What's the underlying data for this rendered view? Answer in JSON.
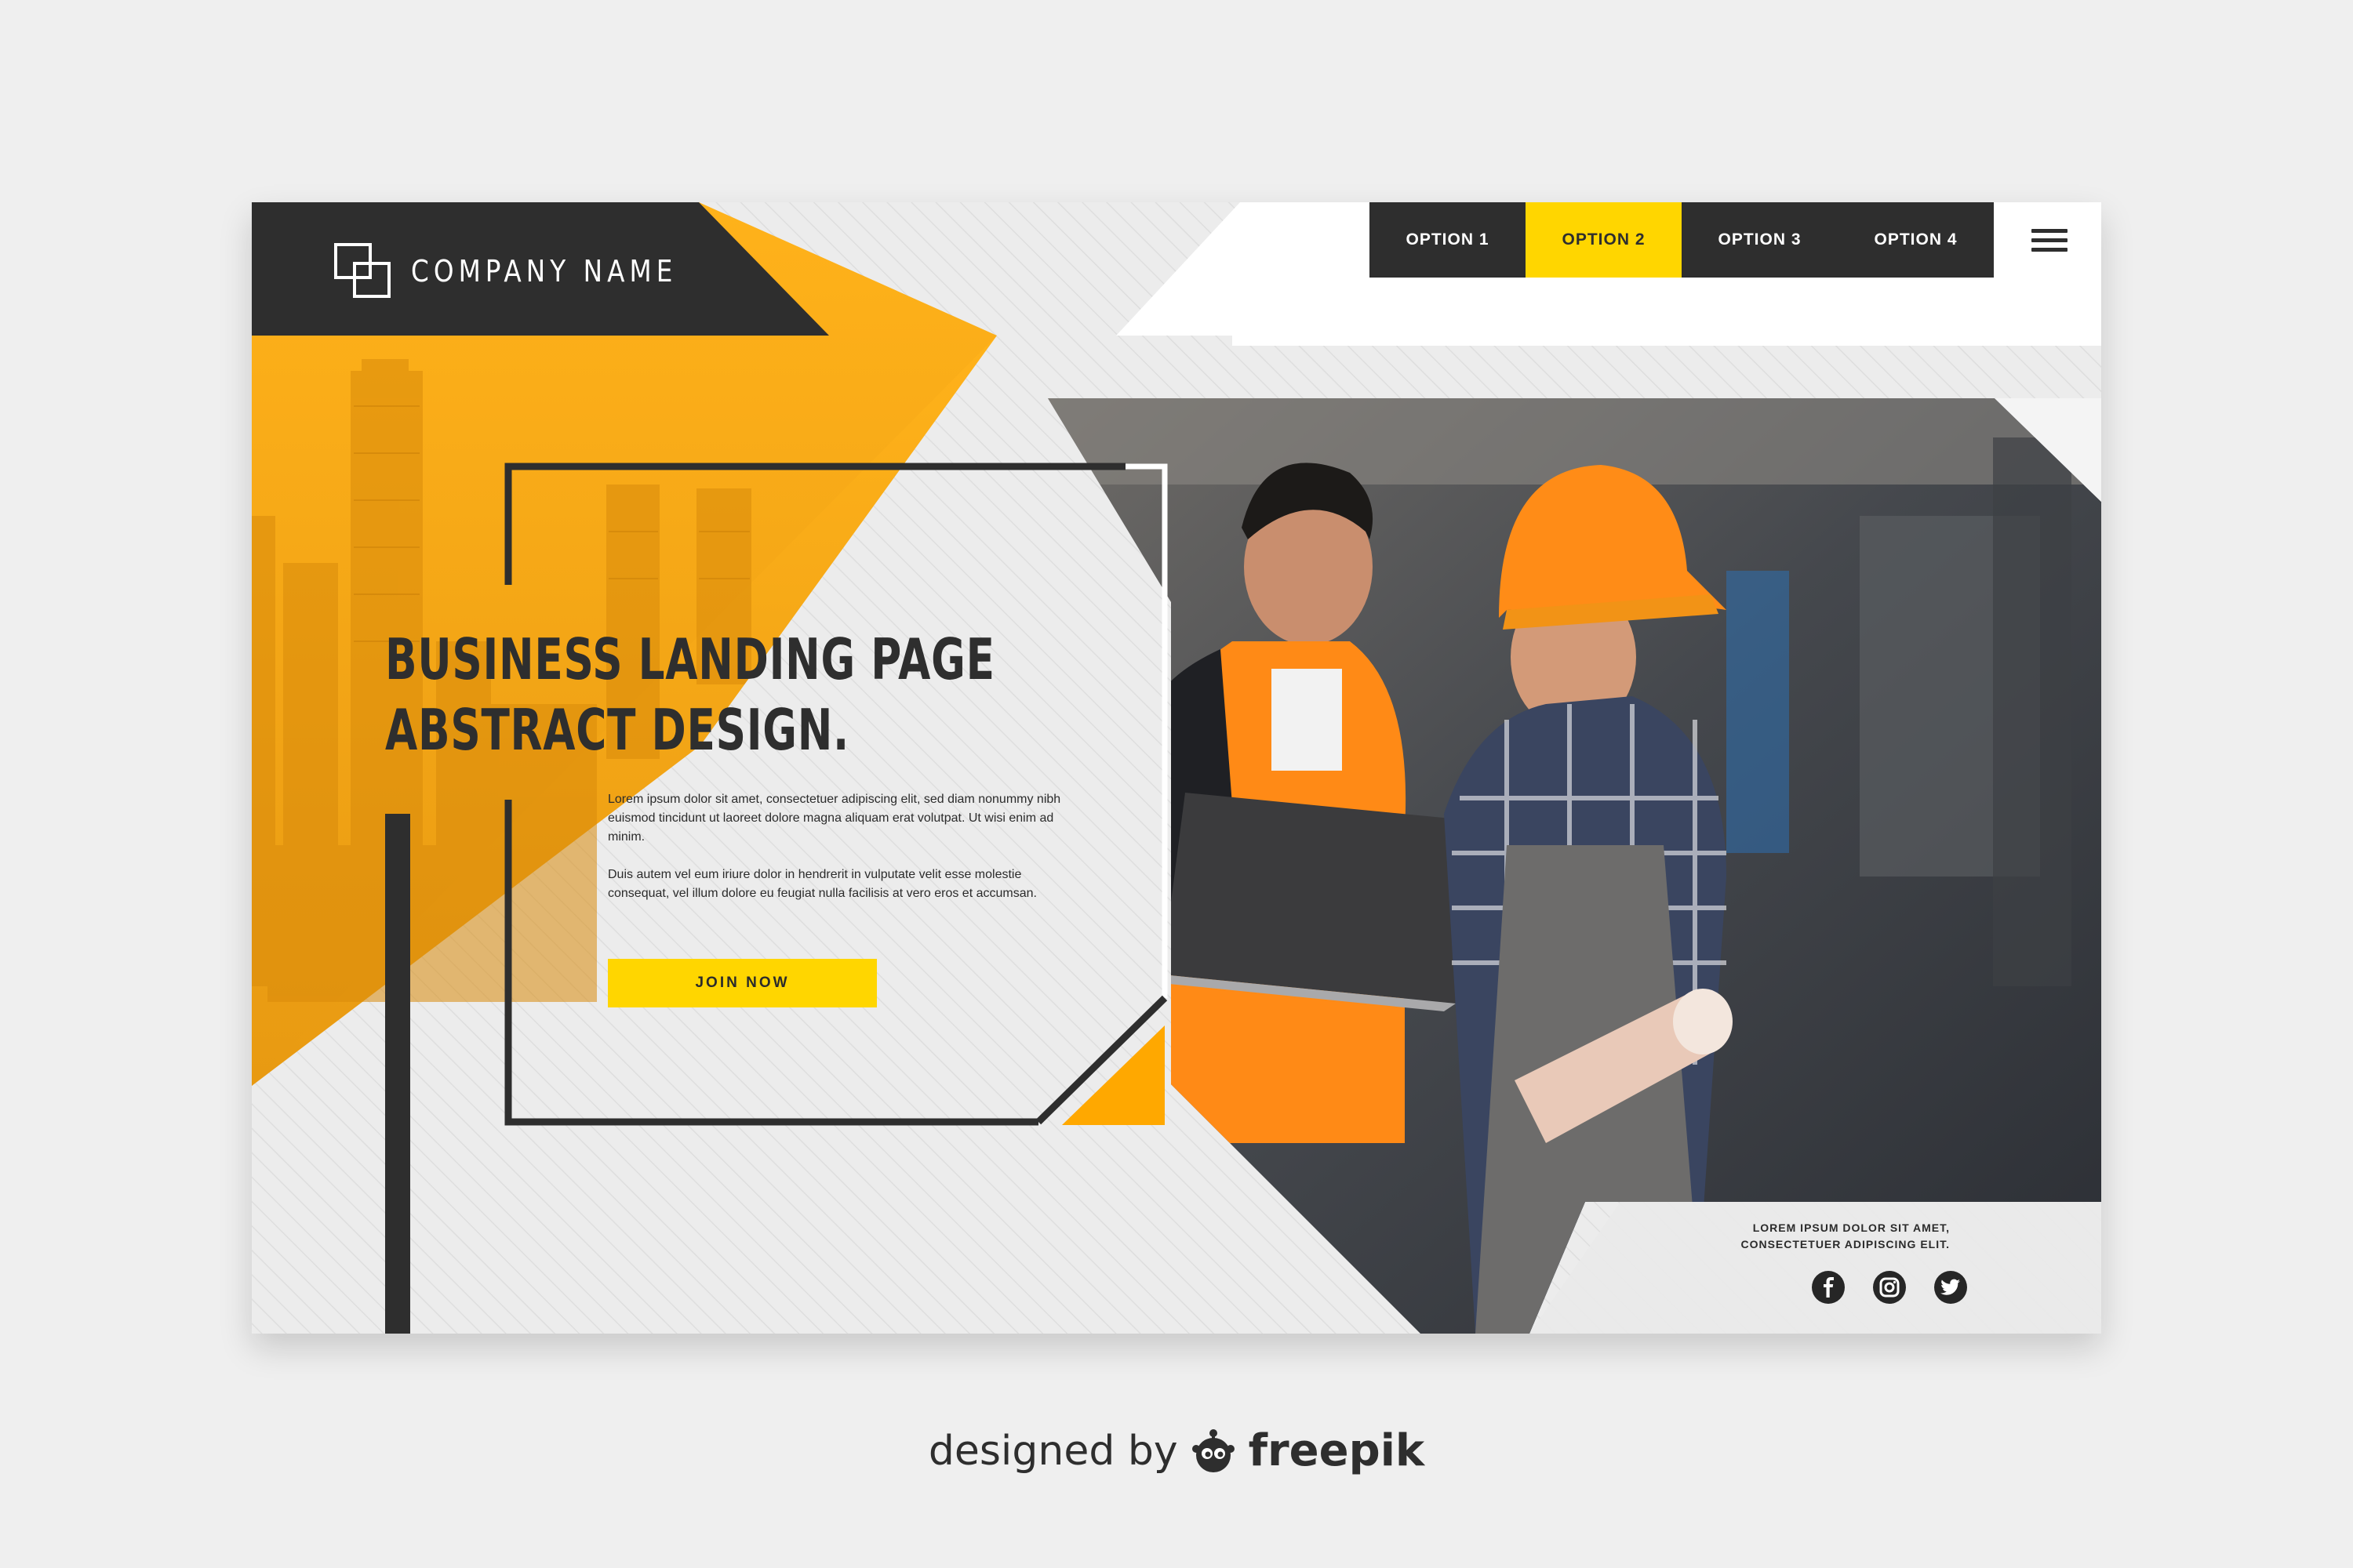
{
  "brand": {
    "company_name": "COMPANY NAME",
    "accent_color": "#ffa800",
    "highlight_color": "#ffd600",
    "dark_color": "#2e2e2e"
  },
  "nav": {
    "items": [
      {
        "label": "OPTION 1"
      },
      {
        "label": "OPTION 2"
      },
      {
        "label": "OPTION 3"
      },
      {
        "label": "OPTION 4"
      }
    ],
    "active_index": 1,
    "menu_icon": "hamburger-icon"
  },
  "hero": {
    "headline_line1": "BUSINESS LANDING PAGE",
    "headline_line2": "ABSTRACT DESIGN.",
    "paragraph1": "Lorem ipsum dolor sit amet, consectetuer adipiscing elit, sed diam nonummy nibh euismod tincidunt ut laoreet dolore magna aliquam erat volutpat. Ut wisi enim ad minim.",
    "paragraph2": "Duis autem vel eum iriure dolor in hendrerit in vulputate velit esse molestie consequat, vel illum dolore eu feugiat nulla facilisis at vero eros et accumsan.",
    "cta_label": "JOIN NOW"
  },
  "footer": {
    "tagline_line1": "LOREM IPSUM DOLOR SIT AMET,",
    "tagline_line2": "CONSECTETUER ADIPISCING ELIT.",
    "social_icons": [
      "facebook-icon",
      "instagram-icon",
      "twitter-icon"
    ]
  },
  "credit": {
    "prefix": "designed by",
    "brand": "freepik"
  }
}
